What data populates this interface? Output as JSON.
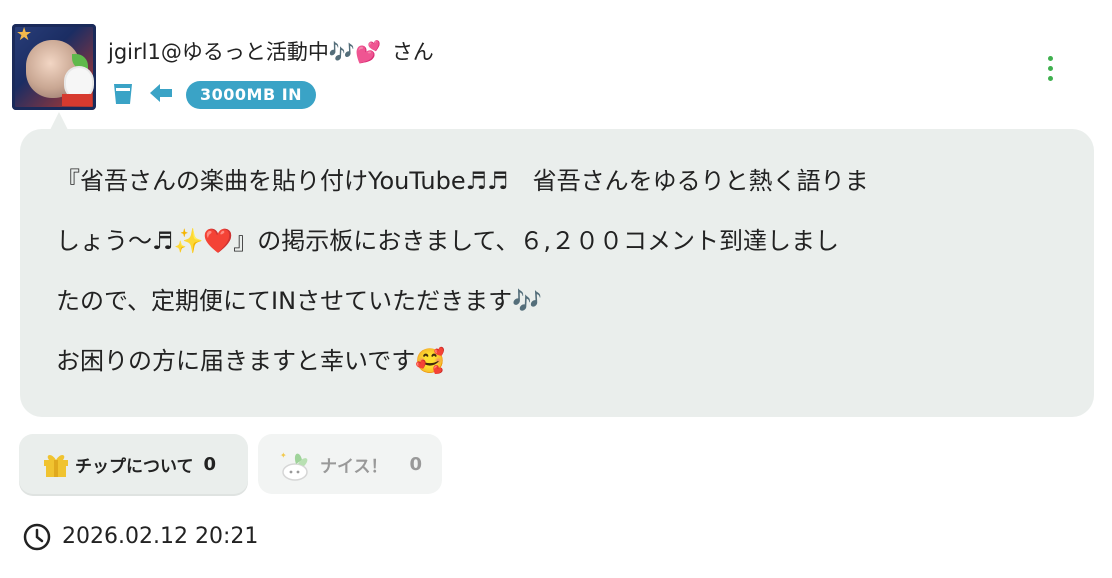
{
  "post": {
    "username": "jgirl1@ゆるっと活動中🎶💕",
    "honorific": "さん",
    "badge": "3000MB IN",
    "body_lines": [
      "『省吾さんの楽曲を貼り付けYouTube♬♬　省吾さんをゆるりと熱く語りま",
      "しょう〜♬✨❤️』の掲示板におきまして、６,２００コメント到達しまし",
      "たので、定期便にてINさせていただきます🎶",
      "お困りの方に届きますと幸いです🥰"
    ],
    "timestamp": "2026.02.12 20:21"
  },
  "actions": {
    "tip_label": "チップについて",
    "tip_count": "0",
    "nice_label": "ナイス！",
    "nice_count": "0"
  },
  "icons": {
    "glass": "glass-icon",
    "arrow": "arrow-left-icon",
    "menu": "kebab-menu-icon",
    "gift": "gift-icon",
    "nice": "radish-mascot-icon",
    "clock": "clock-icon"
  },
  "colors": {
    "accent_blue": "#3aa3c6",
    "menu_green": "#3fb04f",
    "bubble_bg": "#eaeeec",
    "gift_yellow": "#f0c330"
  }
}
